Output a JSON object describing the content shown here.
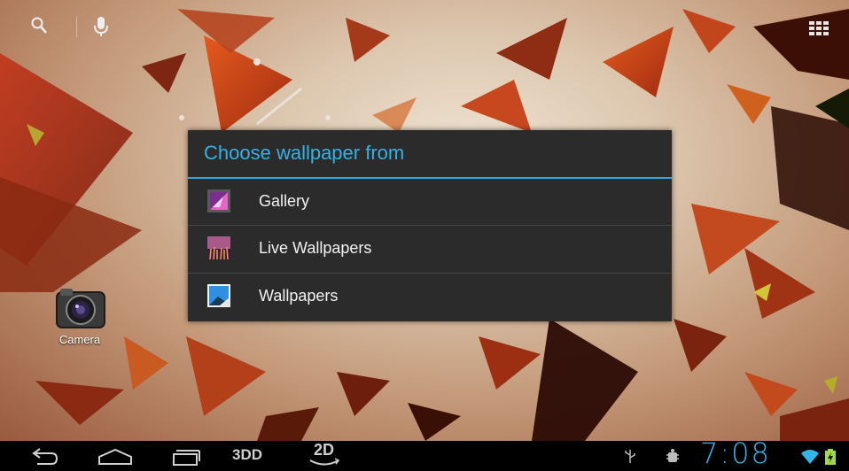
{
  "launcher": {
    "icons": [
      "search-icon",
      "microphone-icon",
      "all-apps-icon"
    ]
  },
  "desktop": {
    "camera_label": "Camera"
  },
  "dialog": {
    "title": "Choose wallpaper from",
    "options": [
      {
        "label": "Gallery",
        "icon": "gallery-icon"
      },
      {
        "label": "Live Wallpapers",
        "icon": "live-wallpapers-icon"
      },
      {
        "label": "Wallpapers",
        "icon": "wallpapers-icon"
      }
    ]
  },
  "navbar": {
    "mode_3d": "3DD",
    "mode_2d": "2D",
    "clock": "7:08"
  },
  "colors": {
    "accent": "#35b2e5",
    "dialog_bg": "#2b2b2b",
    "navbar_bg": "#000000"
  }
}
